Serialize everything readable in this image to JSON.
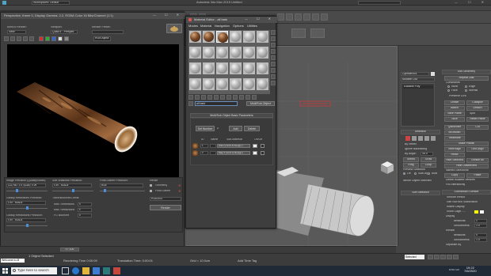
{
  "app": {
    "title": "Autodesk 3ds Max 2019    Untitled",
    "menu_left_label": "Workspaces: Default",
    "window_controls": "— ☐ ✕"
  },
  "render_frame": {
    "title": "Perspective, frame 0, Display Gamma: 2.2, RGBA Color 16 Bits/Channel (1:1)",
    "area_label": "Area to Render:",
    "area_value": "View",
    "viewport_label": "Viewport:",
    "viewport_value": "Quad 4 - Perspec",
    "preset_label": "Render Preset:",
    "preset_value": "",
    "render_button": "Render",
    "channel_value": "RGB Alpha",
    "fg_image_precision_label": "Image Precision (Quality/Noise):",
    "fg_image_precision_value": "Low, Min: 1.0, Quality: 0.25",
    "glossy_reflections_label": "Glossy Reflections Precision:",
    "glossy_reflections_value": "1.0X - Default",
    "glossy_refractions_label": "Glossy Refractions Precision:",
    "glossy_refractions_value": "1.0X - Default",
    "soft_shadow_label": "Soft Shadows Precision:",
    "soft_shadow_value": "1.0X - Default",
    "final_gather_label": "Final Gather Precision:",
    "final_gather_value": "Draft",
    "trace_depth_label": "Trace/Bounces Limits",
    "max_reflections_label": "Max. Reflections",
    "max_reflections_value": "6",
    "max_refractions_label": "Max. Refractions",
    "max_refractions_value": "6",
    "fg_bounces_label": "FG Bounces",
    "fg_bounces_value": "0",
    "reuse_label": "Reuse",
    "geometry_label": "Geometry",
    "final_gather_check": "Final Gather",
    "production_label": "Production",
    "production_render_button": "Render"
  },
  "material_editor": {
    "title": "Material Editor - all bark",
    "menus": [
      "Modes",
      "Material",
      "Navigation",
      "Options",
      "Utilities"
    ],
    "material_name": "all bark",
    "material_type": "Multi/Sub-Object",
    "rollout_title": "Multi/Sub-Object Basic Parameters",
    "set_number_button": "Set Number",
    "add_button": "Add",
    "delete_button": "Delete",
    "num_materials": "2",
    "col_id": "ID",
    "col_name": "Name",
    "col_submaterial": "Sub-Material",
    "col_onoff": "On/Off",
    "rows": [
      {
        "id": "1",
        "sub": "Oak (1 Arch & Design )"
      },
      {
        "id": "2",
        "sub": "Map 2 (Arch & Design )"
      }
    ]
  },
  "viewport": {
    "label": "[+] [Perspective] [Standard] [Default Shading]"
  },
  "command_panel": {
    "object_name": "Cylinder001",
    "modifier_list": "Modifier List",
    "stack_item": "Editable Poly",
    "edit_geometry": "Edit Geometry",
    "repeat_last": "Repeat Last",
    "constraints": "Constraints",
    "none": "None",
    "edge": "Edge",
    "face": "Face",
    "normal": "Normal",
    "preserve_uvs": "Preserve UVs",
    "create": "Create",
    "collapse": "Collapse",
    "attach": "Attach",
    "detach": "Detach",
    "slice_plane": "Slice Plane",
    "split": "Split",
    "slice": "Slice",
    "reset_plane": "Reset Plane",
    "quickslice": "QuickSlice",
    "cut": "Cut",
    "msmooth": "MSmooth",
    "tessellate": "Tessellate",
    "make_planar": "Make Planar",
    "view_align": "View Align",
    "grid_align": "Grid Align",
    "relax": "Relax",
    "hide_selected": "Hide Selected",
    "unhide_all": "Unhide All",
    "hide_unselected": "Hide Unselected",
    "named_selections": "Named Selections:",
    "copy": "Copy",
    "paste": "Paste",
    "delete_isolated": "Delete Isolated Vertices",
    "full_interactivity": "Full Interactivity",
    "selection": "Selection",
    "by_vertex": "By Vertex",
    "ignore_backfacing": "Ignore Backfacing",
    "by_angle": "By Angle:",
    "by_angle_value": "45.0",
    "shrink": "Shrink",
    "grow": "Grow",
    "ring": "Ring",
    "loop": "Loop",
    "preview_selection": "Preview Selection",
    "off": "Off",
    "subobj": "SubObj",
    "multi": "Multi",
    "whole_object": "Whole Object Selected",
    "soft_selection": "Soft Selection",
    "subdivision_surface": "Subdivision Surface",
    "smooth_result": "Smooth Result",
    "use_nurms": "Use NURMS Subdivision",
    "isoline_display": "Isoline Display",
    "show_cage": "Show Cage......",
    "display": "Display",
    "iterations": "Iterations:",
    "iterations_value": "1",
    "smoothness": "Smoothness:",
    "smoothness_value": "1.0",
    "render": "Render",
    "render_iterations_value": "0",
    "render_smoothness_value": "1.0",
    "separate_by": "Separate By"
  },
  "status": {
    "maxscript": "Welcome to M",
    "object_selected": "1 Object Selected",
    "render_time": "Rendering Time  0:00:09",
    "translation_time": "Translation Time: 0:00:01",
    "grid": "Grid = 10.0cm",
    "add_time_tag": "Add Time Tag",
    "selected_dropdown": "Selected",
    "frame_counter": "0 / 100"
  },
  "taskbar": {
    "search_placeholder": "Type here to search",
    "lang": "ENG US",
    "time": "19:22",
    "date": "7/6/2020"
  },
  "colors": {
    "accent_blue": "#4a90d9",
    "wood_light": "#d4a67a",
    "wood_dark": "#3a1f0e"
  }
}
